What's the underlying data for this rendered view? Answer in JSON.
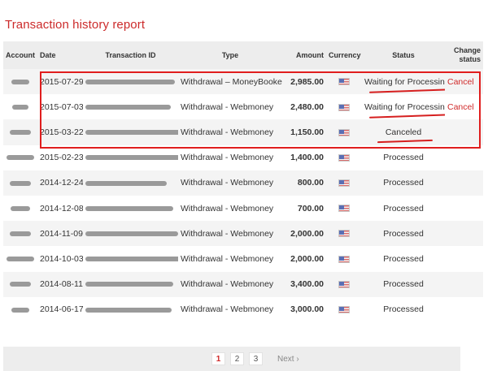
{
  "page": {
    "title": "Transaction history report"
  },
  "table": {
    "columns": {
      "account": "Account",
      "date": "Date",
      "transaction_id": "Transaction ID",
      "type": "Type",
      "amount": "Amount",
      "currency": "Currency",
      "status": "Status",
      "change_status": "Change status"
    },
    "rows": [
      {
        "date": "2015-07-29",
        "type": "Withdrawal – MoneyBookers",
        "amount": "2,985.00",
        "currency_icon": "us-flag-icon",
        "status": "Waiting for Processing",
        "action": "Cancel"
      },
      {
        "date": "2015-07-03",
        "type": "Withdrawal - Webmoney",
        "amount": "2,480.00",
        "currency_icon": "us-flag-icon",
        "status": "Waiting for Processing",
        "action": "Cancel"
      },
      {
        "date": "2015-03-22",
        "type": "Withdrawal - Webmoney",
        "amount": "1,150.00",
        "currency_icon": "us-flag-icon",
        "status": "Canceled",
        "action": ""
      },
      {
        "date": "2015-02-23",
        "type": "Withdrawal - Webmoney",
        "amount": "1,400.00",
        "currency_icon": "us-flag-icon",
        "status": "Processed",
        "action": ""
      },
      {
        "date": "2014-12-24",
        "type": "Withdrawal - Webmoney",
        "amount": "800.00",
        "currency_icon": "us-flag-icon",
        "status": "Processed",
        "action": ""
      },
      {
        "date": "2014-12-08",
        "type": "Withdrawal - Webmoney",
        "amount": "700.00",
        "currency_icon": "us-flag-icon",
        "status": "Processed",
        "action": ""
      },
      {
        "date": "2014-11-09",
        "type": "Withdrawal - Webmoney",
        "amount": "2,000.00",
        "currency_icon": "us-flag-icon",
        "status": "Processed",
        "action": ""
      },
      {
        "date": "2014-10-03",
        "type": "Withdrawal - Webmoney",
        "amount": "2,000.00",
        "currency_icon": "us-flag-icon",
        "status": "Processed",
        "action": ""
      },
      {
        "date": "2014-08-11",
        "type": "Withdrawal - Webmoney",
        "amount": "3,400.00",
        "currency_icon": "us-flag-icon",
        "status": "Processed",
        "action": ""
      },
      {
        "date": "2014-06-17",
        "type": "Withdrawal - Webmoney",
        "amount": "3,000.00",
        "currency_icon": "us-flag-icon",
        "status": "Processed",
        "action": ""
      }
    ]
  },
  "pagination": {
    "pages": [
      "1",
      "2",
      "3"
    ],
    "current": "1",
    "next_label": "Next ›"
  },
  "colors": {
    "title": "#cc2b2b",
    "cancel_link": "#d02a2a",
    "annotation_red": "#e01e1e",
    "header_bg": "#ededed"
  }
}
